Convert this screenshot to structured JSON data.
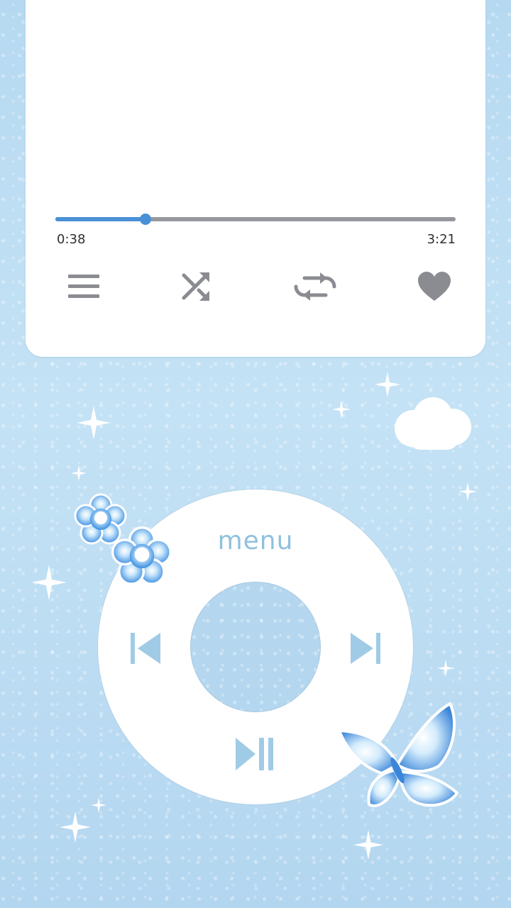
{
  "player": {
    "elapsed": "0:38",
    "total": "3:21",
    "progress_fraction": 0.225
  },
  "controls": {
    "items": [
      {
        "name": "queue-list-icon"
      },
      {
        "name": "shuffle-icon"
      },
      {
        "name": "repeat-icon"
      },
      {
        "name": "heart-icon"
      }
    ]
  },
  "wheel": {
    "menu_label": "menu",
    "prev_icon": "skip-previous-icon",
    "next_icon": "skip-next-icon",
    "playpause_icon": "play-pause-icon"
  },
  "colors": {
    "background": "#b9dcf3",
    "progress_fill": "#4a90d6",
    "progress_track": "#97989d",
    "control_icons": "#8a8c91",
    "wheel_icons": "#9fcbe6"
  }
}
